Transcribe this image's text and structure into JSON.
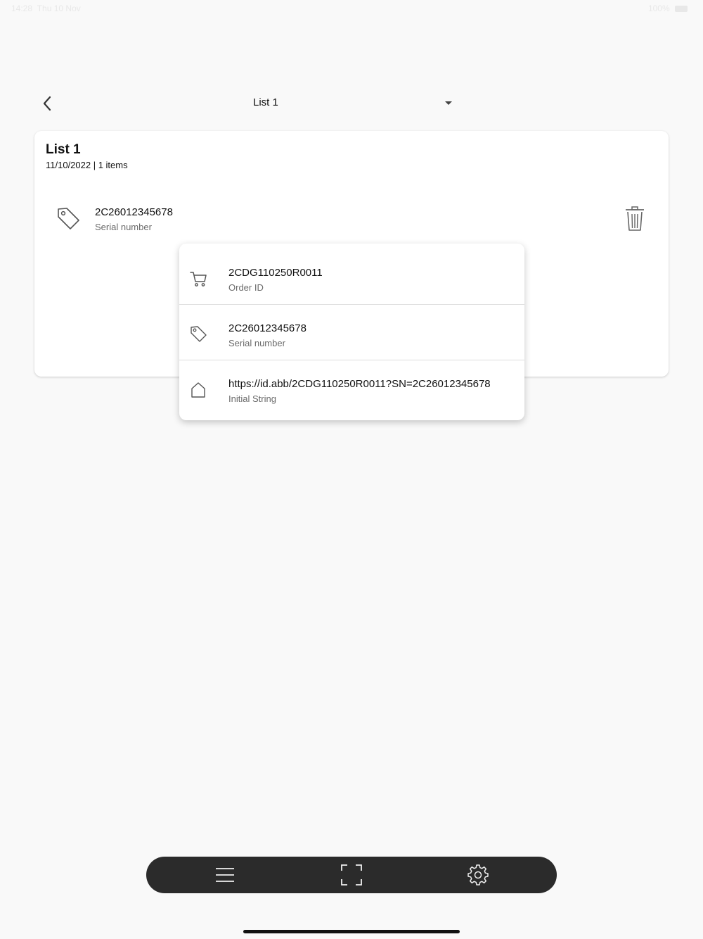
{
  "status_bar": {
    "time": "14:28",
    "date": "Thu 10 Nov",
    "battery": "100%"
  },
  "nav": {
    "back_icon": "chevron-left-icon",
    "list_name": "List 1",
    "dropdown_icon": "caret-down-icon"
  },
  "card": {
    "title": "List 1",
    "meta": "11/10/2022 | 1 items",
    "item": {
      "icon": "tag-icon",
      "value": "2C26012345678",
      "label": "Serial number"
    },
    "delete_icon": "trash-icon"
  },
  "popup": {
    "items": [
      {
        "icon": "cart-icon",
        "value": "2CDG110250R0011",
        "label": "Order ID"
      },
      {
        "icon": "tag-icon",
        "value": "2C26012345678",
        "label": "Serial number"
      },
      {
        "icon": "home-icon",
        "value": "https://id.abb/2CDG110250R0011?SN=2C26012345678",
        "label": "Initial String"
      }
    ]
  },
  "bottom_bar": {
    "items": [
      {
        "icon": "menu-icon"
      },
      {
        "icon": "scan-icon"
      },
      {
        "icon": "gear-icon"
      }
    ],
    "background": "#2b2b2b"
  }
}
